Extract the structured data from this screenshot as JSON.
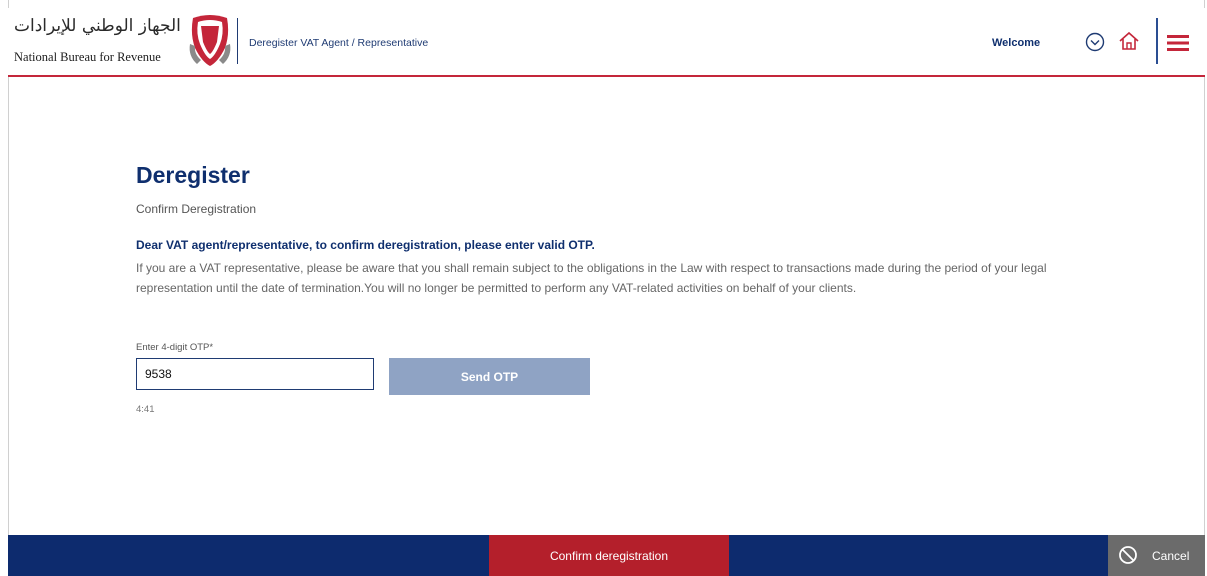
{
  "header": {
    "logo_arabic": "الجهاز الوطني للإيرادات",
    "logo_english": "National Bureau for Revenue",
    "breadcrumb": "Deregister VAT Agent / Representative",
    "welcome": "Welcome"
  },
  "main": {
    "title": "Deregister",
    "subtitle": "Confirm Deregistration",
    "notice_heading": "Dear VAT agent/representative, to confirm deregistration, please enter valid OTP.",
    "notice_body": "If you are a VAT representative, please be aware that you shall remain subject to the obligations in the Law with respect to transactions made during the period of your legal representation until the date of termination.You will no longer be permitted to perform any VAT-related activities on behalf of your clients.",
    "otp": {
      "label": "Enter 4-digit OTP*",
      "value": "9538",
      "send_label": "Send OTP",
      "timer": "4:41"
    }
  },
  "footer": {
    "confirm_label": "Confirm deregistration",
    "cancel_label": "Cancel"
  },
  "colors": {
    "brand_navy": "#0d2b6e",
    "brand_red": "#b41f2b",
    "send_button": "#8fa3c4",
    "cancel_grey": "#6b6b6b"
  },
  "icons": [
    "chevron-down-circle-icon",
    "home-icon",
    "hamburger-menu-icon",
    "cancel-icon",
    "emblem-icon"
  ]
}
